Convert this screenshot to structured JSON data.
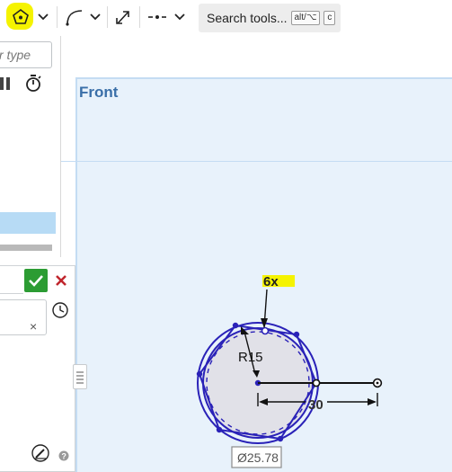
{
  "toolbar": {
    "search": {
      "label": "Search tools...",
      "kbd_modifier": "alt/⌥",
      "kbd_key": "c"
    }
  },
  "left_panel": {
    "filter": {
      "text": "r type"
    }
  },
  "sketch": {
    "plane": "Front",
    "annotations": {
      "pattern_count": "6x",
      "radius": "R15",
      "length": "30",
      "diameter": "Ø25.78"
    }
  },
  "colors": {
    "highlight": "#f5f300",
    "sketch_blue": "#2a22b8",
    "plane_fill": "#e8f2fb",
    "ok_green": "#2c9c33",
    "cancel_red": "#c0262d"
  },
  "icons": [
    "polygon-icon",
    "chevron-down-icon",
    "arc-icon",
    "transform-icon",
    "construction-line-icon",
    "timer-icon",
    "checkmark-icon",
    "close-icon",
    "history-icon",
    "list-icon",
    "sketch-edit-icon",
    "help-icon"
  ]
}
